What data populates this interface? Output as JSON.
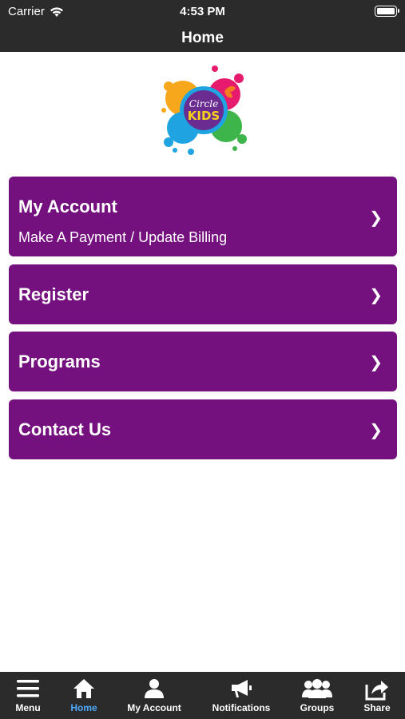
{
  "status_bar": {
    "carrier": "Carrier",
    "time": "4:53 PM",
    "wifi_icon": "wifi-icon",
    "battery_icon": "battery-icon"
  },
  "nav": {
    "title": "Home"
  },
  "logo": {
    "text_top": "Circle",
    "text_bottom": "KIDS"
  },
  "menu": {
    "items": [
      {
        "title": "My Account",
        "subtitle": "Make A Payment / Update Billing",
        "chevron": "❯"
      },
      {
        "title": "Register",
        "chevron": "❯"
      },
      {
        "title": "Programs",
        "chevron": "❯"
      },
      {
        "title": "Contact Us",
        "chevron": "❯"
      }
    ]
  },
  "tab_bar": {
    "active_color": "#4fa9ff",
    "tabs": [
      {
        "label": "Menu",
        "icon": "hamburger-icon"
      },
      {
        "label": "Home",
        "icon": "home-icon",
        "active": true
      },
      {
        "label": "My Account",
        "icon": "person-icon"
      },
      {
        "label": "Notifications",
        "icon": "megaphone-icon"
      },
      {
        "label": "Groups",
        "icon": "group-icon"
      },
      {
        "label": "Share",
        "icon": "share-icon"
      }
    ]
  },
  "colors": {
    "tile_background": "#75107f",
    "bar_background": "#2b2b2b"
  }
}
